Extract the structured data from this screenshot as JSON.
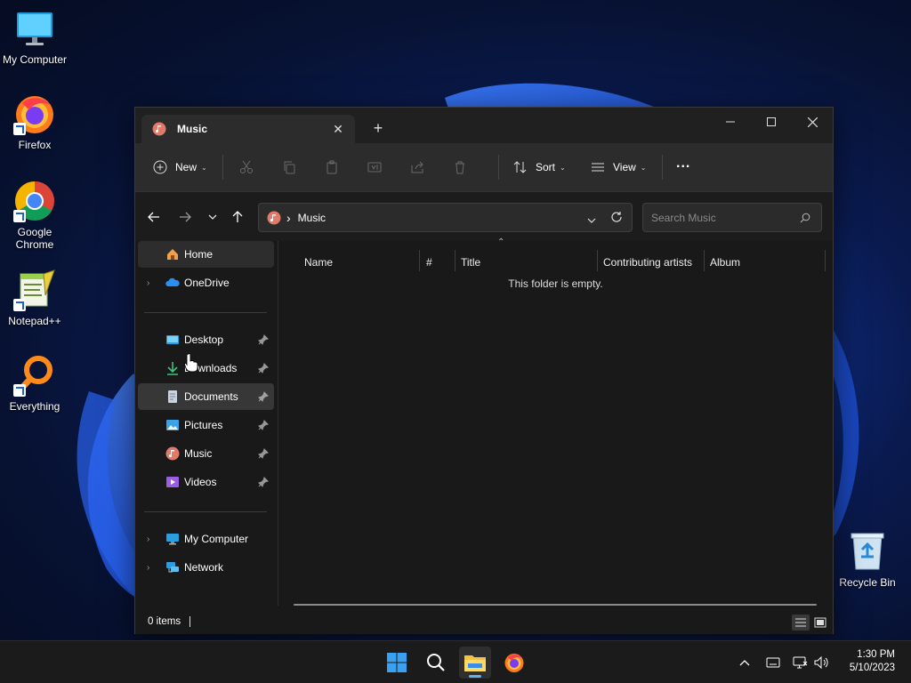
{
  "desktop": {
    "icons": [
      {
        "label": "My Computer",
        "icon": "monitor-icon"
      },
      {
        "label": "Firefox",
        "icon": "firefox-icon"
      },
      {
        "label": "Google Chrome",
        "icon": "chrome-icon"
      },
      {
        "label": "Notepad++",
        "icon": "notepadpp-icon"
      },
      {
        "label": "Everything",
        "icon": "everything-icon"
      }
    ],
    "recycle_bin": {
      "label": "Recycle Bin",
      "icon": "recycle-bin-icon"
    }
  },
  "window": {
    "tab_title": "Music",
    "new_tab_symbol": "+",
    "toolbar": {
      "new_label": "New",
      "sort_label": "Sort",
      "view_label": "View",
      "more_label": "..."
    },
    "address": {
      "separator": "›",
      "path_label": "Music"
    },
    "search": {
      "placeholder": "Search Music"
    },
    "sidebar": {
      "home": "Home",
      "onedrive": "OneDrive",
      "desktop": "Desktop",
      "downloads": "Downloads",
      "documents": "Documents",
      "pictures": "Pictures",
      "music": "Music",
      "videos": "Videos",
      "my_computer": "My Computer",
      "network": "Network"
    },
    "columns": {
      "name": "Name",
      "number": "#",
      "title": "Title",
      "contributing_artists": "Contributing artists",
      "album": "Album"
    },
    "empty_message": "This folder is empty.",
    "status": {
      "items": "0 items"
    }
  },
  "taskbar": {
    "clock_time": "1:30 PM",
    "clock_date": "5/10/2023"
  },
  "colors": {
    "accent": "#5fb2f2",
    "window_bg": "#191919",
    "toolbar_bg": "#2c2c2c"
  }
}
